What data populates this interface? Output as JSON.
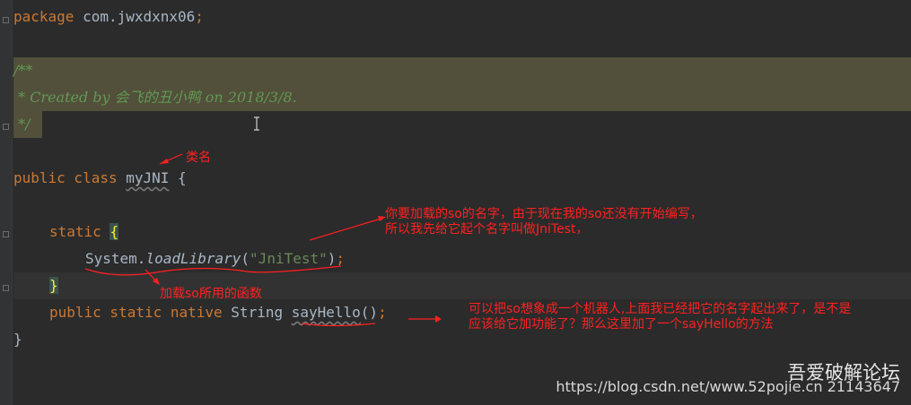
{
  "code": {
    "l1_kw": "package",
    "l1_pkg": " com.jwxdxnx06",
    "l1_semi": ";",
    "doc_l1": "/**",
    "doc_l2": " * Created by 会飞的丑小鸭 on 2018/3/8.",
    "doc_l3": " */",
    "l4_kw": "public class ",
    "l4_name": "myJNI",
    "l4_rest": " {",
    "l5_kw": "static ",
    "l5_brace": "{",
    "l6_obj": "System.",
    "l6_method": "loadLibrary",
    "l6_open": "(",
    "l6_str": "\"JniTest\"",
    "l6_close": ")",
    "l6_semi": ";",
    "l7_brace": "}",
    "l8_kw": "public static native ",
    "l8_type": "String ",
    "l8_method": "sayHello",
    "l8_parens": "()",
    "l8_semi": ";",
    "l9_brace": "}"
  },
  "annotations": {
    "class_name": "类名",
    "so_name": "你要加载的so的名字，由于现在我的so还没有开始编写，\n所以我先给它起个名字叫做JniTest，",
    "load_func": "加载so所用的函数",
    "robot": "可以把so想象成一个机器人,上面我已经把它的名字起出来了，是不是\n应该给它加功能了？那么这里加了一个sayHello的方法"
  },
  "watermark": {
    "site": "吾爱破解论坛",
    "url": "https://blog.csdn.net/www.52pojie.cn 21143647"
  },
  "colors": {
    "background": "#2b2b2b",
    "keyword": "#cc7832",
    "doc_comment": "#629755",
    "string": "#6a8759",
    "annotation": "#ff2020",
    "doc_highlight": "#52503a"
  }
}
